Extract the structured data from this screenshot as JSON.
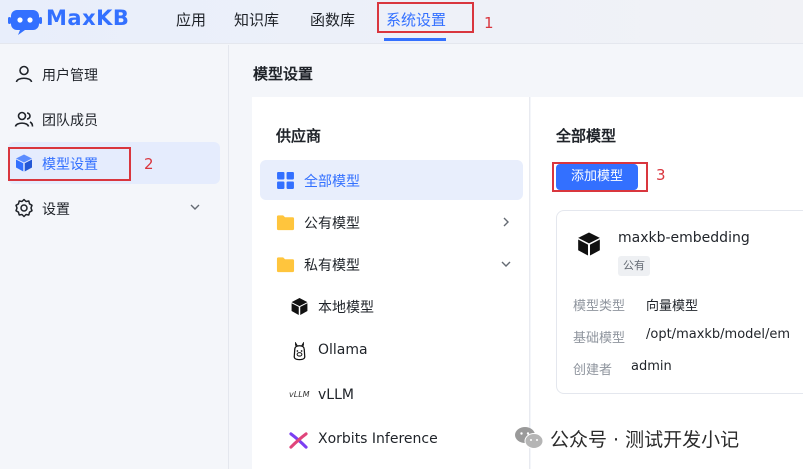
{
  "app": {
    "name": "MaxKB"
  },
  "nav": {
    "items": [
      {
        "label": "应用"
      },
      {
        "label": "知识库"
      },
      {
        "label": "函数库"
      },
      {
        "label": "系统设置",
        "active": true
      }
    ]
  },
  "annotations": {
    "n1": "1",
    "n2": "2",
    "n3": "3"
  },
  "sidebar": {
    "items": [
      {
        "label": "用户管理",
        "icon": "user-icon"
      },
      {
        "label": "团队成员",
        "icon": "team-icon"
      },
      {
        "label": "模型设置",
        "icon": "cube-icon",
        "active": true
      },
      {
        "label": "设置",
        "icon": "gear-icon",
        "expandable": true
      }
    ]
  },
  "page": {
    "title": "模型设置"
  },
  "providers": {
    "heading": "供应商",
    "items": [
      {
        "label": "全部模型",
        "icon": "grid-icon",
        "active": true
      },
      {
        "label": "公有模型",
        "icon": "folder-icon",
        "chevron": "right"
      },
      {
        "label": "私有模型",
        "icon": "folder-icon",
        "chevron": "down"
      },
      {
        "label": "本地模型",
        "icon": "cube-icon"
      },
      {
        "label": "Ollama",
        "icon": "llama-icon"
      },
      {
        "label": "vLLM",
        "icon": "vllm-icon",
        "icon_text": "vLLM"
      },
      {
        "label": "Xorbits Inference",
        "icon": "xorbits-icon"
      }
    ]
  },
  "models": {
    "heading": "全部模型",
    "add_button": "添加模型",
    "card": {
      "name": "maxkb-embedding",
      "badge": "公有",
      "fields": [
        {
          "key": "模型类型",
          "value": "向量模型"
        },
        {
          "key": "基础模型",
          "value": "/opt/maxkb/model/em"
        },
        {
          "key": "创建者",
          "value": "admin"
        }
      ]
    }
  },
  "watermark": {
    "text": "公众号 · 测试开发小记"
  },
  "colors": {
    "accent": "#3370ff",
    "annotation": "#d9363e"
  }
}
